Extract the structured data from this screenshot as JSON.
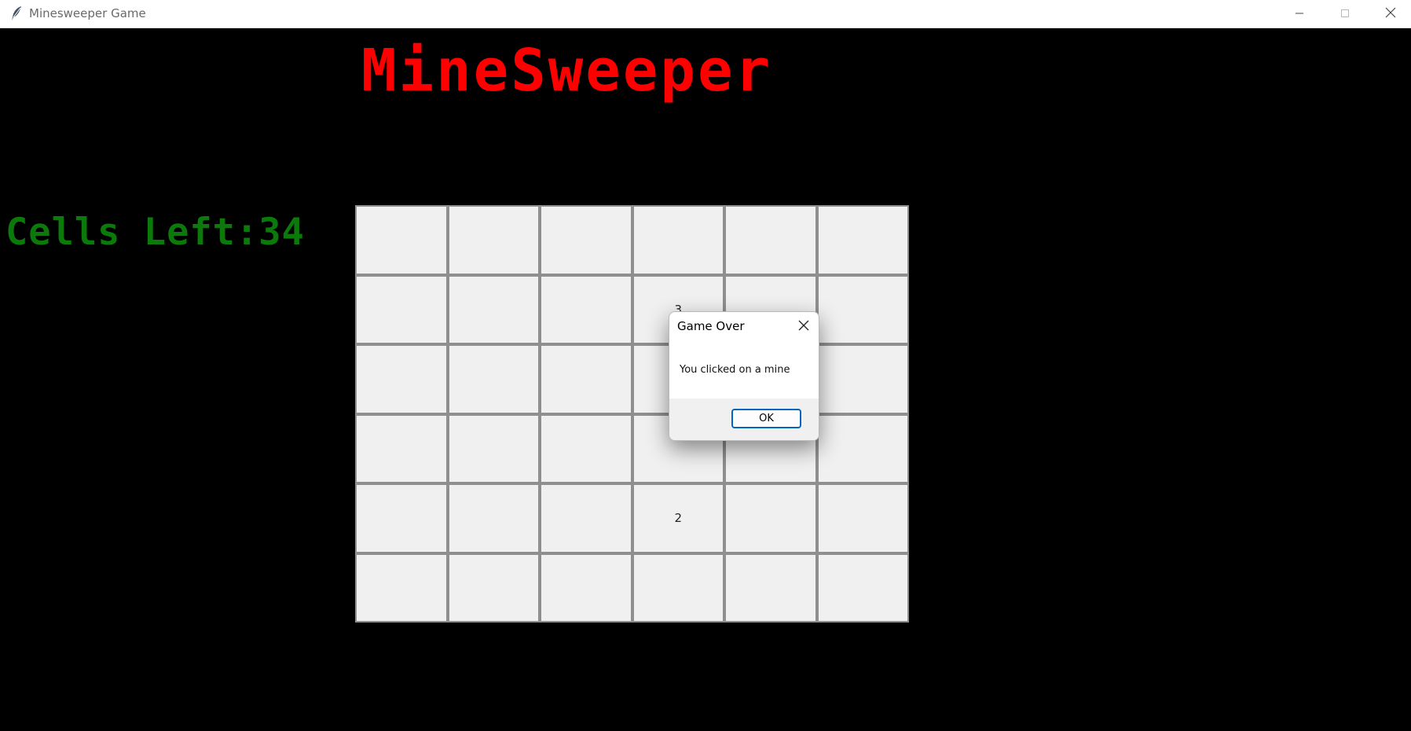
{
  "window": {
    "title": "Minesweeper Game",
    "icons": {
      "app": "feather-icon",
      "minimize": "minimize-icon",
      "maximize": "maximize-icon",
      "close": "close-icon"
    }
  },
  "game": {
    "title": "MineSweeper",
    "cells_left_text": "Cells Left:34",
    "colors": {
      "title": "#ff0000",
      "cells_left": "#0b7a0b",
      "background": "#000000"
    }
  },
  "board": {
    "rows": [
      [
        "",
        "",
        "",
        "",
        "",
        ""
      ],
      [
        "",
        "",
        "",
        "3",
        "",
        ""
      ],
      [
        "",
        "",
        "",
        "",
        "",
        ""
      ],
      [
        "",
        "",
        "",
        "",
        "",
        ""
      ],
      [
        "",
        "",
        "",
        "2",
        "",
        ""
      ],
      [
        "",
        "",
        "",
        "",
        "",
        ""
      ]
    ]
  },
  "dialog": {
    "title": "Game Over",
    "message": "You clicked on a mine",
    "ok_label": "OK",
    "close_icon": "close-icon"
  }
}
